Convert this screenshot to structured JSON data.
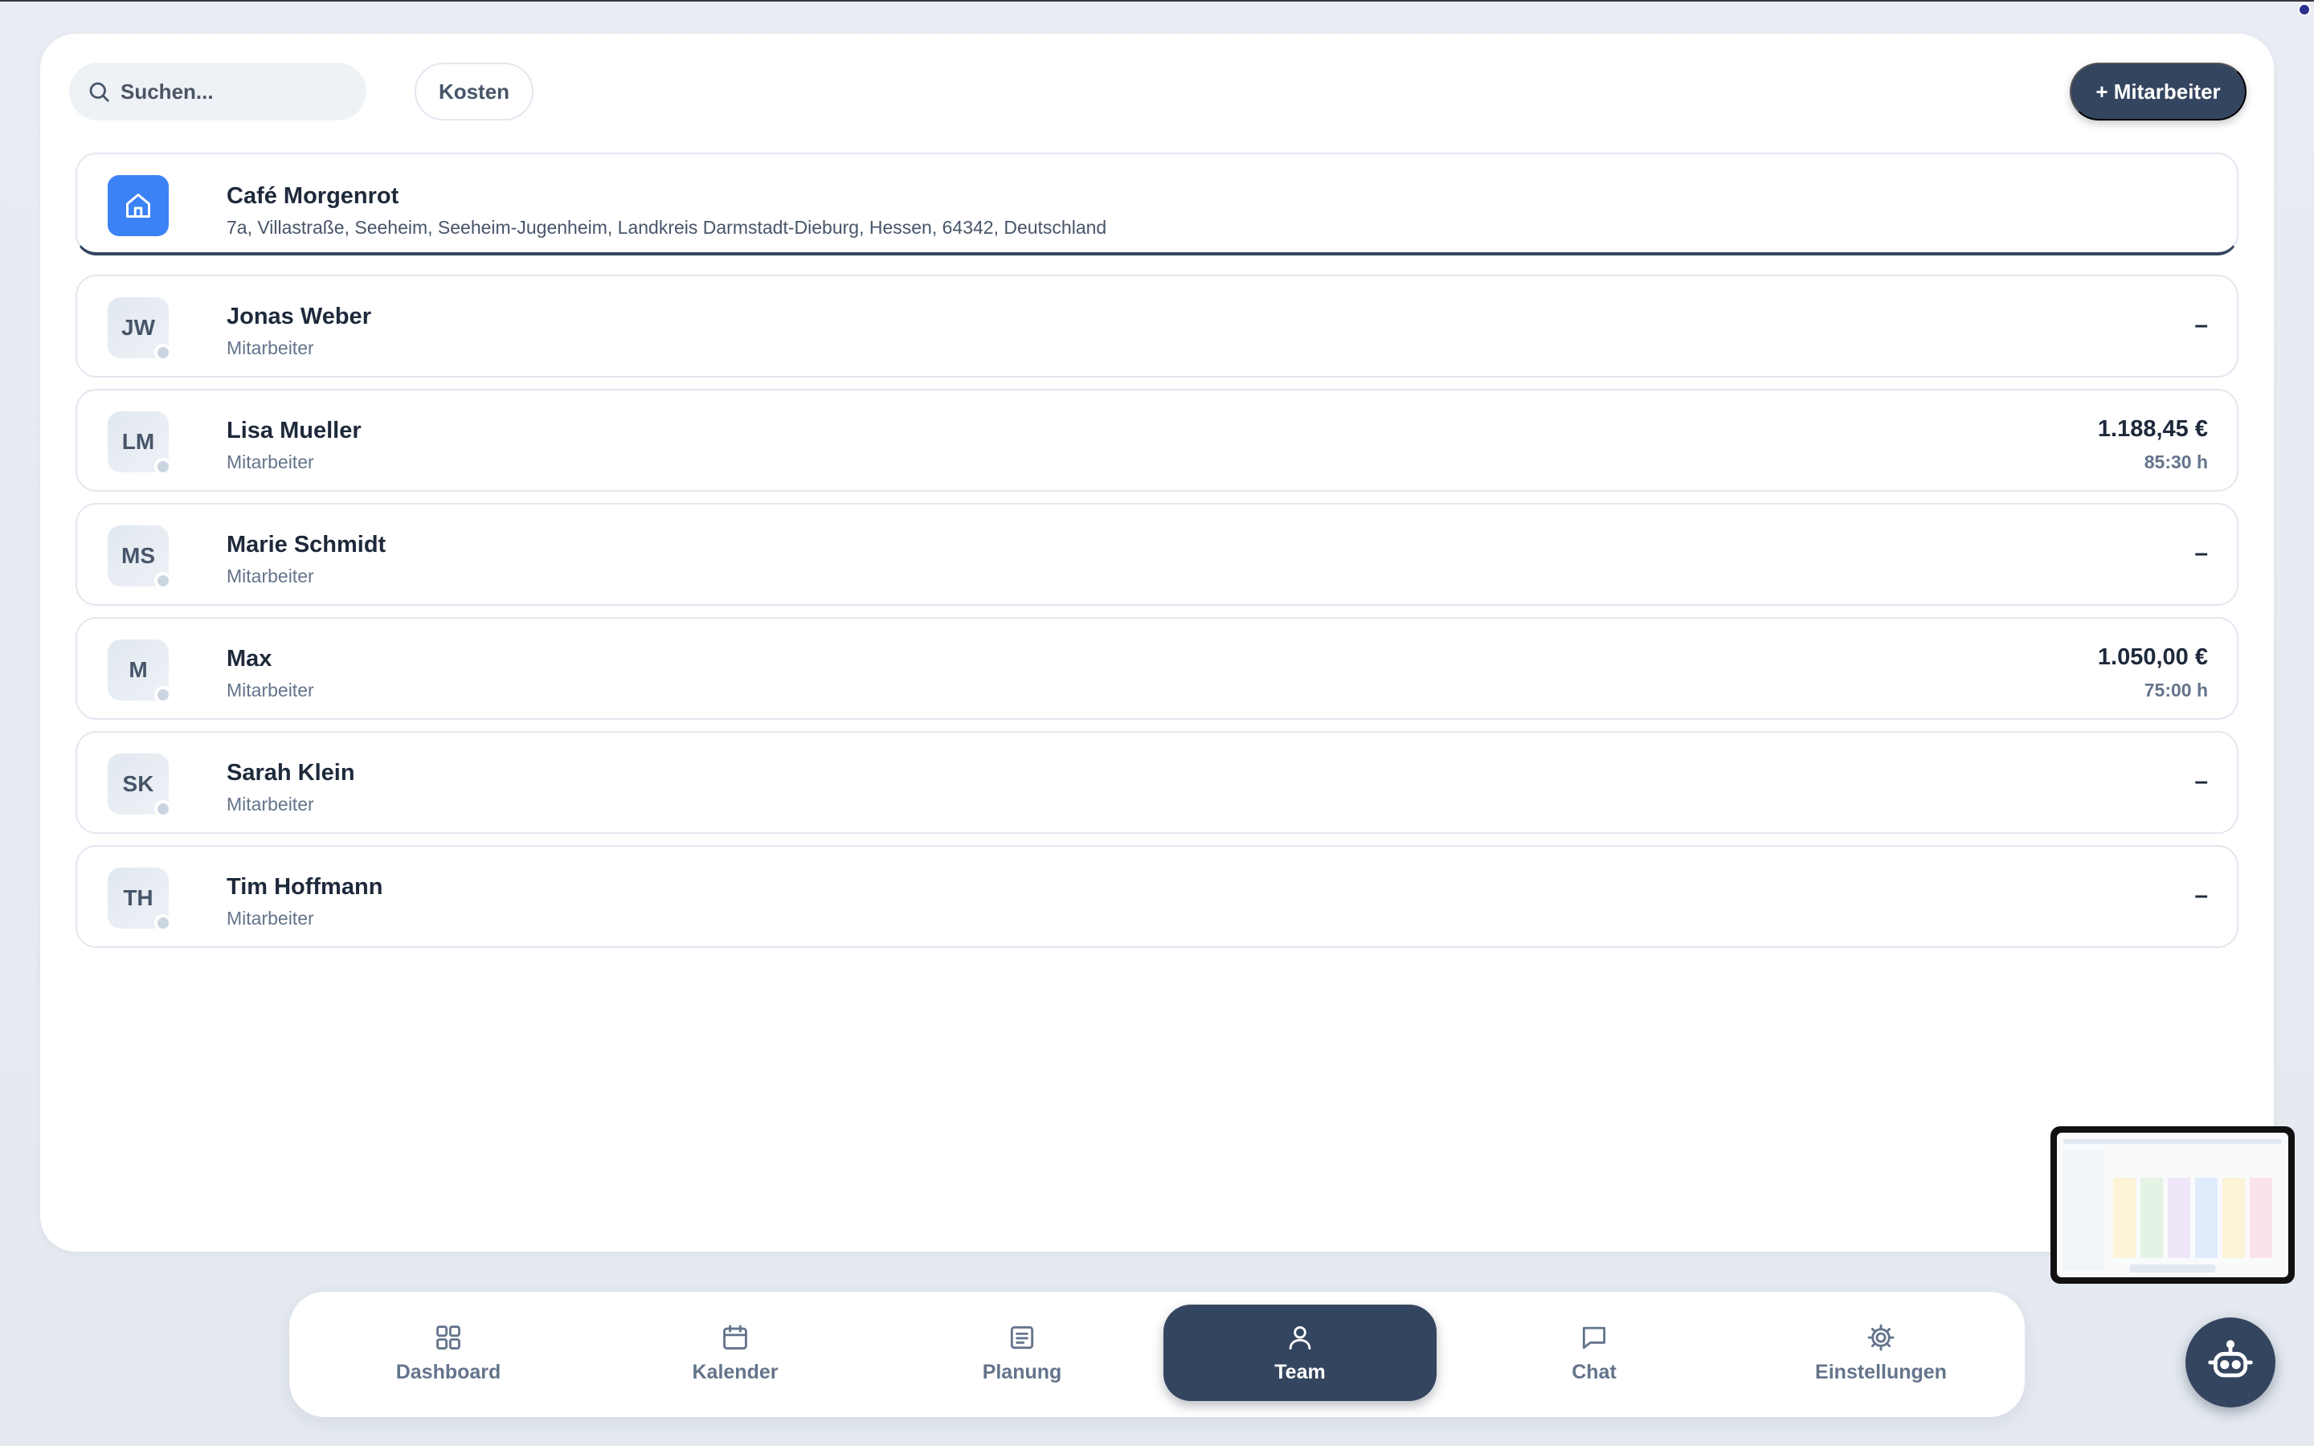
{
  "toolbar": {
    "search_placeholder": "Suchen...",
    "kosten_label": "Kosten",
    "add_label": "+ Mitarbeiter"
  },
  "location": {
    "name": "Café Morgenrot",
    "address": "7a, Villastraße, Seeheim, Seeheim-Jugenheim, Landkreis Darmstadt-Dieburg, Hessen, 64342, Deutschland",
    "icon": "home-icon"
  },
  "members": [
    {
      "initials": "JW",
      "name": "Jonas Weber",
      "role": "Mitarbeiter",
      "cost": "–",
      "hours": ""
    },
    {
      "initials": "LM",
      "name": "Lisa Mueller",
      "role": "Mitarbeiter",
      "cost": "1.188,45 €",
      "hours": "85:30 h"
    },
    {
      "initials": "MS",
      "name": "Marie Schmidt",
      "role": "Mitarbeiter",
      "cost": "–",
      "hours": ""
    },
    {
      "initials": "M",
      "name": "Max",
      "role": "Mitarbeiter",
      "cost": "1.050,00 €",
      "hours": "75:00 h"
    },
    {
      "initials": "SK",
      "name": "Sarah Klein",
      "role": "Mitarbeiter",
      "cost": "–",
      "hours": ""
    },
    {
      "initials": "TH",
      "name": "Tim Hoffmann",
      "role": "Mitarbeiter",
      "cost": "–",
      "hours": ""
    }
  ],
  "nav": {
    "items": [
      {
        "label": "Dashboard",
        "icon": "grid-icon"
      },
      {
        "label": "Kalender",
        "icon": "calendar-icon"
      },
      {
        "label": "Planung",
        "icon": "document-icon"
      },
      {
        "label": "Team",
        "icon": "user-icon"
      },
      {
        "label": "Chat",
        "icon": "chat-icon"
      },
      {
        "label": "Einstellungen",
        "icon": "gear-icon"
      }
    ],
    "active": "Team"
  },
  "colors": {
    "primary": "#34455f",
    "accent": "#3b82f6",
    "background": "#e9edf3"
  }
}
